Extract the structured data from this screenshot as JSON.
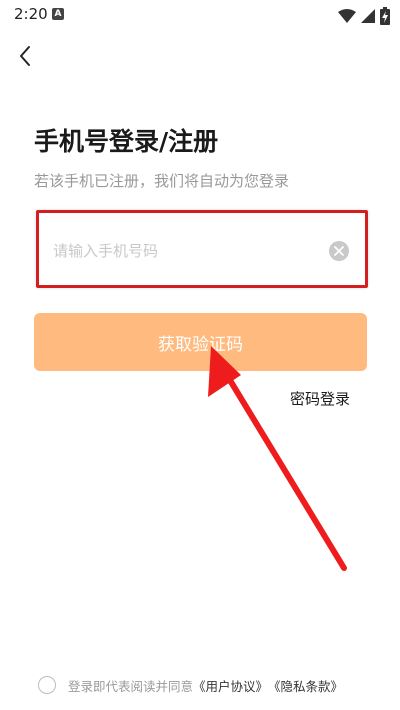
{
  "status_bar": {
    "time": "2:20",
    "notification_badge": "A",
    "icons": [
      "wifi-icon",
      "signal-icon",
      "battery-charging-icon"
    ]
  },
  "nav": {
    "back_icon": "chevron-left-icon"
  },
  "login": {
    "title": "手机号登录/注册",
    "subtitle": "若该手机已注册，我们将自动为您登录",
    "phone_placeholder": "请输入手机号码",
    "phone_value": "",
    "get_code_label": "获取验证码",
    "password_login_label": "密码登录"
  },
  "agreement": {
    "prefix": "登录即代表阅读并同意",
    "user_agreement": "《用户协议》",
    "privacy_policy": "《隐私条款》",
    "checked": false
  },
  "colors": {
    "primary_button": "#ffbb7f",
    "highlight_box": "#d31f1f",
    "annotation_arrow": "#ee1c1c",
    "placeholder": "#c8c8c8"
  }
}
